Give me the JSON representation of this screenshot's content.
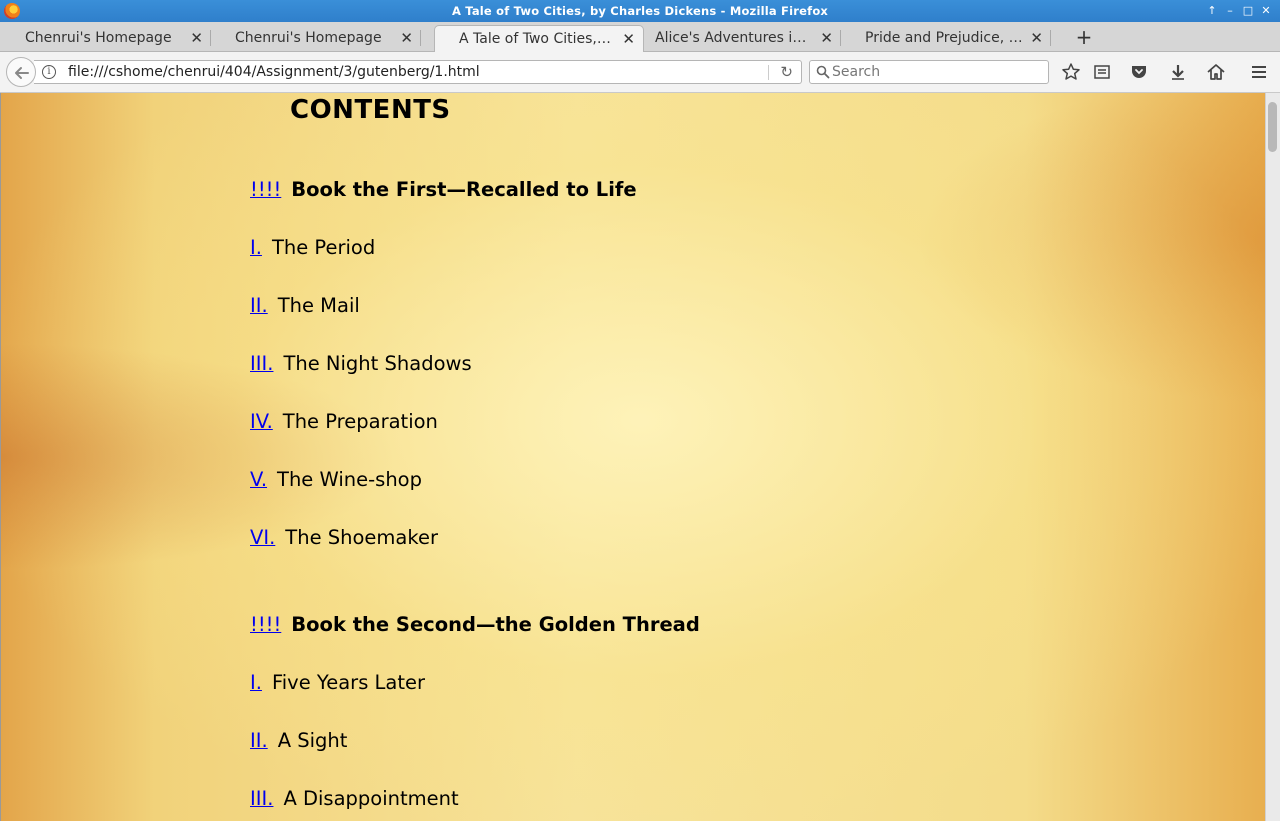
{
  "window": {
    "title": "A Tale of Two Cities, by Charles Dickens - Mozilla Firefox",
    "controls": [
      "↑",
      "–",
      "□",
      "✕"
    ]
  },
  "tabs": [
    {
      "label": "Chenrui's Homepage",
      "active": false
    },
    {
      "label": "Chenrui's Homepage",
      "active": false
    },
    {
      "label": "A Tale of Two Cities, by Charles Dickens",
      "active": true
    },
    {
      "label": "Alice's Adventures in Wonderland",
      "active": false
    },
    {
      "label": "Pride and Prejudice, by Jane Austen",
      "active": false
    }
  ],
  "tab_close_glyph": "✕",
  "new_tab_glyph": "+",
  "navbar": {
    "url": "file:///cshome/chenrui/404/Assignment/3/gutenberg/1.html",
    "info_glyph": "i",
    "reload_glyph": "↻",
    "search_placeholder": "Search"
  },
  "page": {
    "heading": "CONTENTS",
    "entries": [
      {
        "kind": "book",
        "link": "!!!!",
        "title": "Book the First—Recalled to Life"
      },
      {
        "kind": "chapter",
        "link": "I.",
        "title": "The Period"
      },
      {
        "kind": "chapter",
        "link": "II.",
        "title": "The Mail"
      },
      {
        "kind": "chapter",
        "link": "III.",
        "title": "The Night Shadows"
      },
      {
        "kind": "chapter",
        "link": "IV.",
        "title": "The Preparation"
      },
      {
        "kind": "chapter",
        "link": "V.",
        "title": "The Wine-shop"
      },
      {
        "kind": "chapter",
        "link": "VI.",
        "title": "The Shoemaker"
      },
      {
        "kind": "book",
        "link": "!!!!",
        "title": "Book the Second—the Golden Thread"
      },
      {
        "kind": "chapter",
        "link": "I.",
        "title": "Five Years Later"
      },
      {
        "kind": "chapter",
        "link": "II.",
        "title": "A Sight"
      },
      {
        "kind": "chapter",
        "link": "III.",
        "title": "A Disappointment"
      }
    ]
  },
  "colors": {
    "link": "#0000ee",
    "titlebar": "#2f7fcb"
  }
}
